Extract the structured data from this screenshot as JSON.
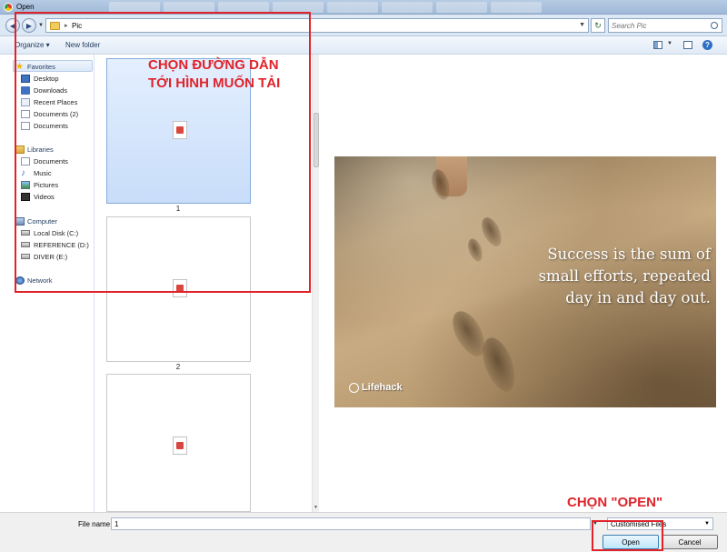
{
  "window": {
    "title": "Open"
  },
  "address": {
    "path": "Pic",
    "search_placeholder": "Search Pic"
  },
  "toolbar": {
    "organize": "Organize ▾",
    "new_folder": "New folder"
  },
  "nav": {
    "favorites": "Favorites",
    "favorites_items": [
      "Desktop",
      "Downloads",
      "Recent Places",
      "Documents (2)",
      "Documents"
    ],
    "libraries": "Libraries",
    "libraries_items": [
      "Documents",
      "Music",
      "Pictures",
      "Videos"
    ],
    "computer": "Computer",
    "computer_items": [
      "Local Disk (C:)",
      "REFERENCE (D:)",
      "DIVER (E:)"
    ],
    "network": "Network"
  },
  "files": [
    {
      "name": "1",
      "selected": true
    },
    {
      "name": "2",
      "selected": false
    },
    {
      "name": "",
      "selected": false
    }
  ],
  "preview": {
    "quote": "Success is the sum of small efforts, repeated day in and day out.",
    "brand": "Lifehack"
  },
  "bottom": {
    "file_name_label": "File name:",
    "file_name_value": "1",
    "file_type": "Customised Files",
    "open_label": "Open",
    "cancel_label": "Cancel"
  },
  "annotations": {
    "path_line1": "CHỌN ĐƯỜNG DẪN",
    "path_line2": "TỚI HÌNH MUỐN TẢI",
    "open_note": "CHỌN \"OPEN\"",
    "color": "#e0232a"
  }
}
